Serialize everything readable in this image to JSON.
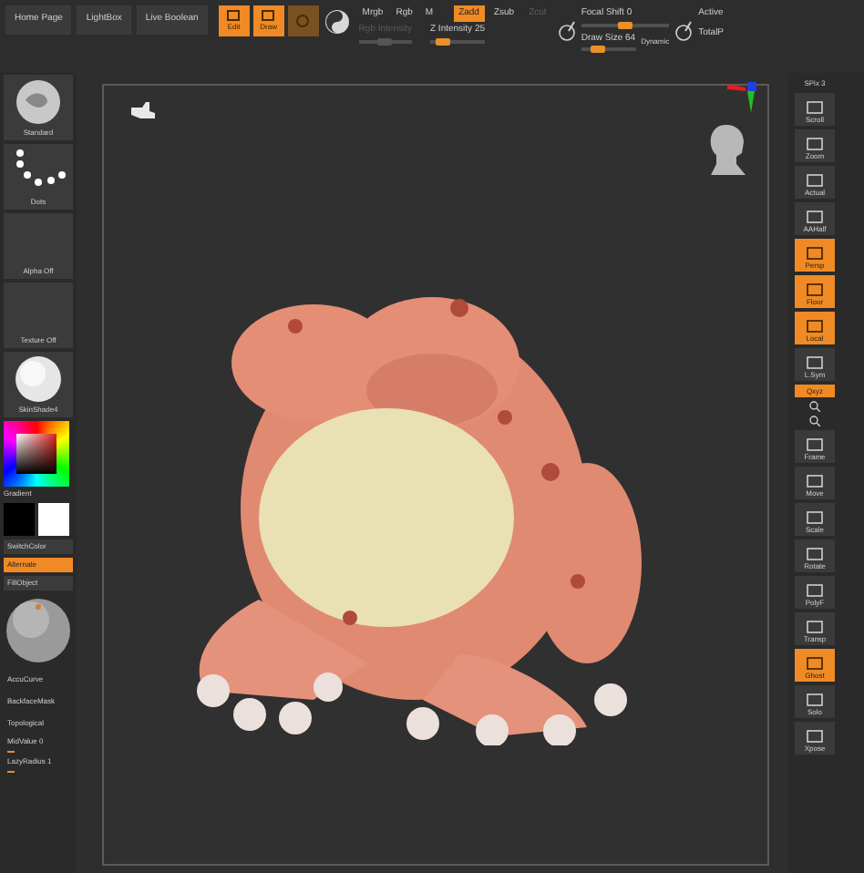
{
  "top_bar": {
    "nav_buttons": [
      "Home Page",
      "LightBox",
      "Live Boolean"
    ],
    "tools": [
      {
        "label": "Edit",
        "selected": true
      },
      {
        "label": "Draw",
        "selected": true
      },
      {
        "selected": false
      }
    ],
    "channels": [
      {
        "label": "Mrgb",
        "selected": false
      },
      {
        "label": "Rgb",
        "selected": false
      },
      {
        "label": "M",
        "selected": false
      }
    ],
    "z_modes": [
      {
        "label": "Zadd",
        "selected": true,
        "disabled": false
      },
      {
        "label": "Zsub",
        "selected": false,
        "disabled": false
      },
      {
        "label": "Zcut",
        "selected": false,
        "disabled": true
      }
    ],
    "rgb_intensity": {
      "label": "Rgb Intensity",
      "disabled": true,
      "level": 0.5
    },
    "z_intensity": {
      "label": "Z Intensity 25",
      "level": 0.25
    },
    "focal_shift": {
      "label": "Focal Shift 0",
      "level": 0.5
    },
    "draw_size": {
      "label": "Draw Size 64",
      "level": 0.32
    },
    "dynamic": "Dynamic",
    "points": [
      "Active",
      "TotalP"
    ]
  },
  "left_panel": [
    {
      "kind": "brush",
      "label": "Standard"
    },
    {
      "kind": "stroke",
      "label": "Dots"
    },
    {
      "kind": "empty",
      "label": "Alpha Off"
    },
    {
      "kind": "empty",
      "label": "Texture Off"
    },
    {
      "kind": "material",
      "label": "SkinShade4"
    },
    {
      "kind": "picker",
      "label": "Gradient"
    },
    {
      "kind": "swatches"
    },
    {
      "kind": "text",
      "label": "SwitchColor",
      "selected": false
    },
    {
      "kind": "text",
      "label": "Alternate",
      "selected": true
    },
    {
      "kind": "text",
      "label": "FillObject",
      "selected": false
    },
    {
      "kind": "sphere"
    },
    {
      "kind": "plain",
      "label": "AccuCurve"
    },
    {
      "kind": "plain",
      "label": "BackfaceMask"
    },
    {
      "kind": "plain",
      "label": "Topological"
    },
    {
      "kind": "slider",
      "label": "MidValue 0",
      "level": 0.1
    },
    {
      "kind": "slider",
      "label": "LazyRadius 1",
      "level": 0.1
    }
  ],
  "right_shelf": [
    {
      "kind": "text",
      "label": "SPix 3",
      "selected": false
    },
    {
      "kind": "button",
      "label": "Scroll",
      "selected": false
    },
    {
      "kind": "button",
      "label": "Zoom",
      "selected": false
    },
    {
      "kind": "button",
      "label": "Actual",
      "selected": false
    },
    {
      "kind": "button",
      "label": "AAHalf",
      "selected": false
    },
    {
      "kind": "button",
      "label": "Persp",
      "selected": true
    },
    {
      "kind": "button",
      "label": "Floor",
      "selected": true
    },
    {
      "kind": "button",
      "label": "Local",
      "selected": true
    },
    {
      "kind": "button",
      "label": "L.Sym",
      "selected": false
    },
    {
      "kind": "text",
      "label": "Qxyz",
      "selected": true
    },
    {
      "kind": "zoomicons"
    },
    {
      "kind": "button",
      "label": "Frame",
      "selected": false
    },
    {
      "kind": "button",
      "label": "Move",
      "selected": false
    },
    {
      "kind": "button",
      "label": "Scale",
      "selected": false
    },
    {
      "kind": "button",
      "label": "Rotate",
      "selected": false
    },
    {
      "kind": "button",
      "label": "PolyF",
      "selected": false
    },
    {
      "kind": "button",
      "label": "Transp",
      "selected": false
    },
    {
      "kind": "button",
      "label": "Ghost",
      "selected": true
    },
    {
      "kind": "button",
      "label": "Solo",
      "selected": false
    },
    {
      "kind": "button",
      "label": "Xpose",
      "selected": false
    }
  ]
}
